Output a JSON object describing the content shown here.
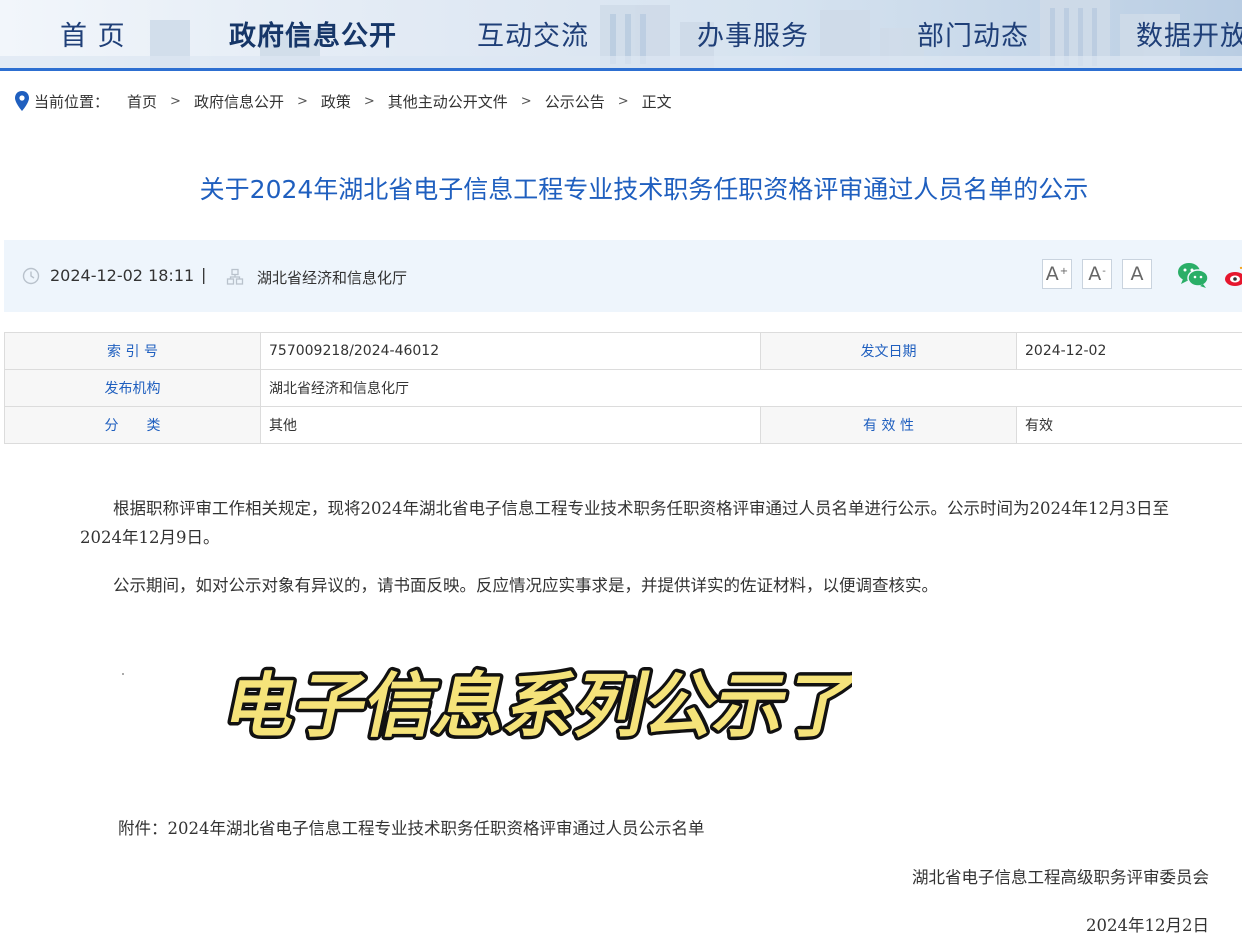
{
  "nav": {
    "items": [
      {
        "label": "首 页"
      },
      {
        "label": "政府信息公开"
      },
      {
        "label": "互动交流"
      },
      {
        "label": "办事服务"
      },
      {
        "label": "部门动态"
      },
      {
        "label": "数据开放"
      }
    ],
    "active_index": 1
  },
  "breadcrumb": {
    "prefix": "当前位置：",
    "items": [
      "首页",
      "政府信息公开",
      "政策",
      "其他主动公开文件",
      "公示公告",
      "正文"
    ],
    "separator": ">"
  },
  "article": {
    "title": "关于2024年湖北省电子信息工程专业技术职务任职资格评审通过人员名单的公示",
    "datetime": "2024-12-02 18:11",
    "divider": "|",
    "source": "湖北省经济和信息化厅",
    "font_buttons": [
      {
        "label": "A",
        "sup": "+"
      },
      {
        "label": "A",
        "sup": "-"
      },
      {
        "label": "A",
        "sup": ""
      }
    ],
    "share_icons": [
      "wechat-icon",
      "weibo-icon"
    ]
  },
  "info_table": {
    "rows": [
      {
        "k1": "索 引 号",
        "v1": "757009218/2024-46012",
        "k2": "发文日期",
        "v2": "2024-12-02"
      },
      {
        "k1": "发布机构",
        "v1": "湖北省经济和信息化厅"
      },
      {
        "k1": "分　　类",
        "v1": "其他",
        "k2": "有 效 性",
        "v2": "有效"
      }
    ]
  },
  "body": {
    "para1": "根据职称评审工作相关规定，现将2024年湖北省电子信息工程专业技术职务任职资格评审通过人员名单进行公示。公示时间为2024年12月3日至2024年12月9日。",
    "para2": "公示期间，如对公示对象有异议的，请书面反映。反应情况应实事求是，并提供详实的佐证材料，以便调查核实。",
    "banner_text": "电子信息系列公示了",
    "attachment": "附件：2024年湖北省电子信息工程专业技术职务任职资格评审通过人员公示名单",
    "signature": "湖北省电子信息工程高级职务评审委员会",
    "sign_date": "2024年12月2日"
  },
  "colors": {
    "nav_text": "#1f3f78",
    "accent_blue": "#1f5fbf",
    "nav_underline": "#2d6fd1",
    "meta_bg": "#eef5fc",
    "banner_fill": "#f5e37a",
    "banner_outline": "#111111"
  }
}
